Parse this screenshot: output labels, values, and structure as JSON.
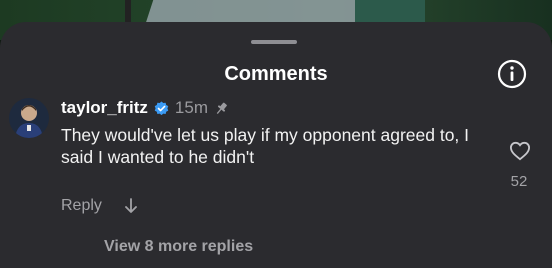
{
  "sheet": {
    "title": "Comments"
  },
  "comment": {
    "username": "taylor_fritz",
    "timestamp": "15m",
    "text": "They would've let us play if my opponent agreed to, I said I wanted to he didn't",
    "like_count": "52",
    "reply_label": "Reply",
    "view_more_replies": "View 8 more replies",
    "icons": {
      "verified": "verified-badge-icon",
      "pinned": "pin-icon",
      "like": "heart-icon",
      "expand": "arrow-down-icon",
      "info": "info-icon"
    }
  },
  "colors": {
    "sheet_background": "#2b2b2f",
    "verified_blue": "#3b9bf5",
    "secondary_text": "#a3a3a7"
  }
}
